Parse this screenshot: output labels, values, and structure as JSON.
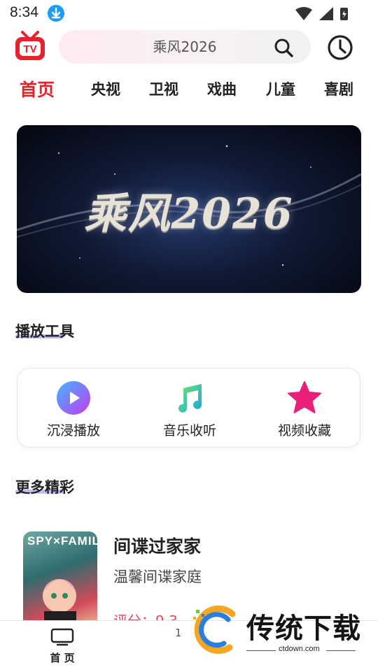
{
  "status_bar": {
    "time": "8:34"
  },
  "header": {
    "search_text": "乘风2026"
  },
  "tabs": [
    "首页",
    "央视",
    "卫视",
    "戏曲",
    "儿童",
    "喜剧"
  ],
  "banner": {
    "title": "乘风2026"
  },
  "tools_section": {
    "title": "播放工具",
    "items": [
      {
        "label": "沉浸播放",
        "icon": "play-icon"
      },
      {
        "label": "音乐收听",
        "icon": "music-note-icon"
      },
      {
        "label": "视频收藏",
        "icon": "star-icon"
      }
    ]
  },
  "more_section": {
    "title": "更多精彩",
    "item": {
      "poster_text": "SPY×FAMILY",
      "title": "间谍过家家",
      "description": "温馨间谍家庭",
      "rating": "评分：9.3"
    }
  },
  "bottom_nav": {
    "home_label": "首 页",
    "second_label": "1"
  },
  "watermark": {
    "text": "传统下载",
    "url": "ctdown.com"
  },
  "colors": {
    "accent": "#e8222c",
    "underline": "#b4b3f3",
    "star": "#e8207a",
    "note": "#19c3d8"
  }
}
